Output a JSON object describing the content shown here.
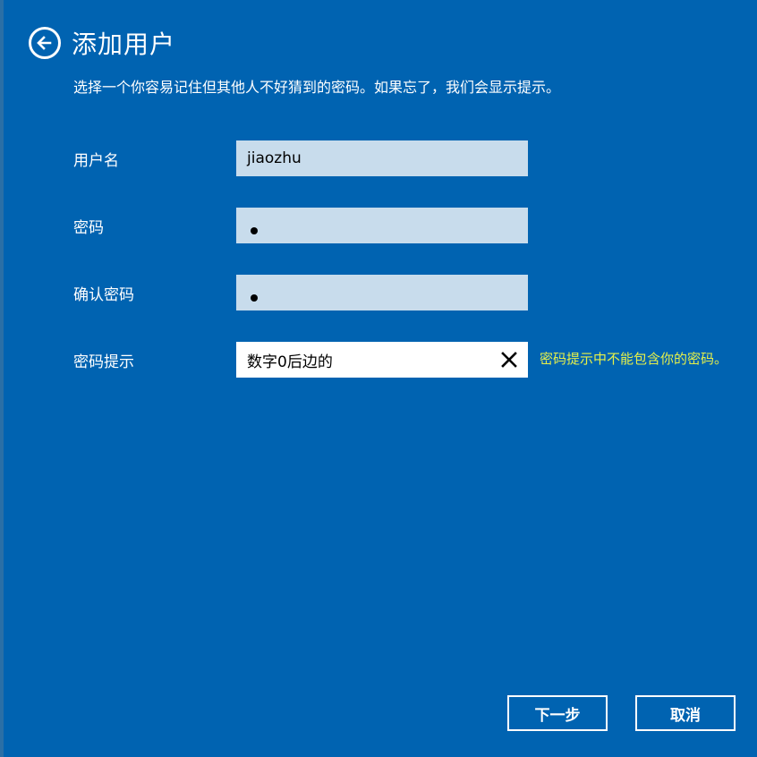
{
  "header": {
    "title": "添加用户",
    "subtitle": "选择一个你容易记住但其他人不好猜到的密码。如果忘了，我们会显示提示。"
  },
  "form": {
    "username": {
      "label": "用户名",
      "value": "jiaozhu"
    },
    "password": {
      "label": "密码",
      "value": "•"
    },
    "confirm_password": {
      "label": "确认密码",
      "value": "•"
    },
    "password_hint": {
      "label": "密码提示",
      "value": "数字0后边的",
      "error": "密码提示中不能包含你的密码。"
    }
  },
  "buttons": {
    "next": "下一步",
    "cancel": "取消"
  },
  "icons": {
    "back": "back-arrow-icon",
    "clear": "close-icon"
  },
  "colors": {
    "background": "#0063b1",
    "input_bg": "#c8dcec",
    "error_text": "#e6f04a"
  }
}
